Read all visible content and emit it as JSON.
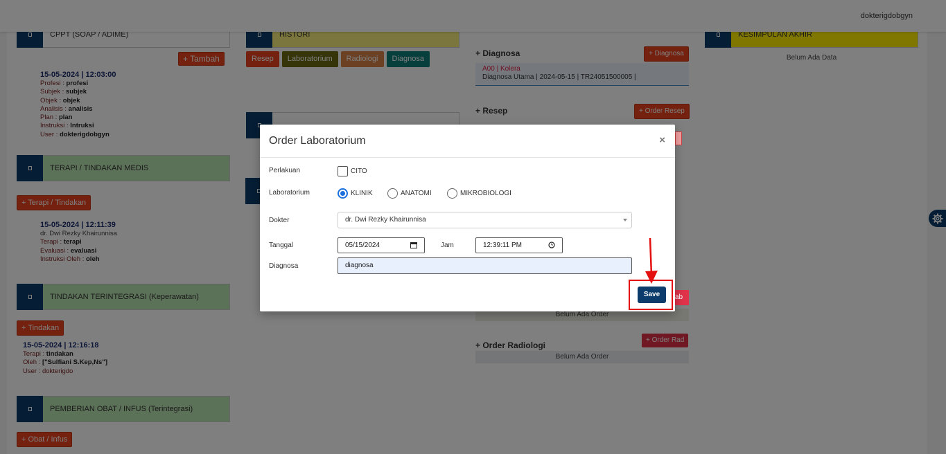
{
  "topbar": {
    "username": "dokterigdobgyn"
  },
  "left": {
    "cppt": {
      "title": "CPPT (SOAP / ADIME)",
      "add_label": "+ Tambah",
      "entry": {
        "datetime": "15-05-2024 | 12:03:00",
        "rows": [
          {
            "k": "Profesi : ",
            "v": "profesi"
          },
          {
            "k": "Subjek : ",
            "v": "subjek"
          },
          {
            "k": "Objek : ",
            "v": "objek"
          },
          {
            "k": "Analisis : ",
            "v": "analisis"
          },
          {
            "k": "Plan : ",
            "v": "plan"
          },
          {
            "k": "Instruksi : ",
            "v": "Intruksi"
          },
          {
            "k": "User : ",
            "v": "dokterigdobgyn"
          }
        ]
      }
    },
    "terapi": {
      "title": "TERAPI / TINDAKAN MEDIS",
      "add_label": "+ Terapi / Tindakan",
      "entry": {
        "datetime": "15-05-2024 | 12:11:39",
        "doctor": "dr. Dwi Rezky Khairunnisa",
        "rows": [
          {
            "k": "Terapi : ",
            "v": "terapi"
          },
          {
            "k": "Evaluasi : ",
            "v": "evaluasi"
          },
          {
            "k": "Instruksi Oleh : ",
            "v": "oleh"
          }
        ]
      }
    },
    "tindakan": {
      "title": "TINDAKAN TERINTEGRASI (Keperawatan)",
      "add_label": "+ Tindakan",
      "entry": {
        "datetime": "15-05-2024 | 12:16:18",
        "rows": [
          {
            "k": "Terapi : ",
            "v": "tindakan"
          },
          {
            "k": "Oleh : ",
            "v": "[\"Sulfiani S.Kep,Ns\"]"
          }
        ],
        "user": "User : dokterigdo"
      }
    },
    "obat": {
      "title": "PEMBERIAN OBAT / INFUS (Terintegrasi)",
      "add_label": "+ Obat / Infus"
    }
  },
  "middle": {
    "histori": {
      "title": "HISTORI"
    },
    "tabs": [
      {
        "label": "Resep",
        "color": "#e8441f"
      },
      {
        "label": "Laboratorium",
        "color": "#6b6b12"
      },
      {
        "label": "Radiologi",
        "color": "#d98347"
      },
      {
        "label": "Diagnosa",
        "color": "#0d7e78"
      }
    ]
  },
  "right_mid": {
    "diagnosa": {
      "title": "+ Diagnosa",
      "btn": "+ Diagnosa",
      "code": "A00 | Kolera",
      "detail": "Diagnosa Utama | 2024-05-15 | TR24051500005 |"
    },
    "resep": {
      "title": "+ Resep",
      "btn": "+ Order Resep"
    },
    "lab_empty": "Belum Ada Order",
    "radiologi": {
      "title": "+ Order Radiologi",
      "btn": "+ Order Rad",
      "empty": "Belum Ada Order"
    }
  },
  "right": {
    "title": "KESIMPULAN AKHIR",
    "empty": "Belum Ada Data"
  },
  "modal": {
    "title": "Order Laboratorium",
    "close": "×",
    "perlakuan_label": "Perlakuan",
    "cito_label": "CITO",
    "lab_label": "Laboratorium",
    "lab_options": [
      "KLINIK",
      "ANATOMI",
      "MIKROBIOLOGI"
    ],
    "lab_selected": "KLINIK",
    "dokter_label": "Dokter",
    "dokter_value": "dr. Dwi Rezky Khairunnisa",
    "tanggal_label": "Tanggal",
    "tanggal_value": "05/15/2024",
    "jam_label": "Jam",
    "jam_value": "12:39:11 PM",
    "diagnosa_label": "Diagnosa",
    "diagnosa_value": "diagnosa",
    "save_label": "Save"
  },
  "colors": {
    "primary": "#0b3c6b",
    "danger": "#e8441f",
    "highlight": "#e40f0f"
  }
}
